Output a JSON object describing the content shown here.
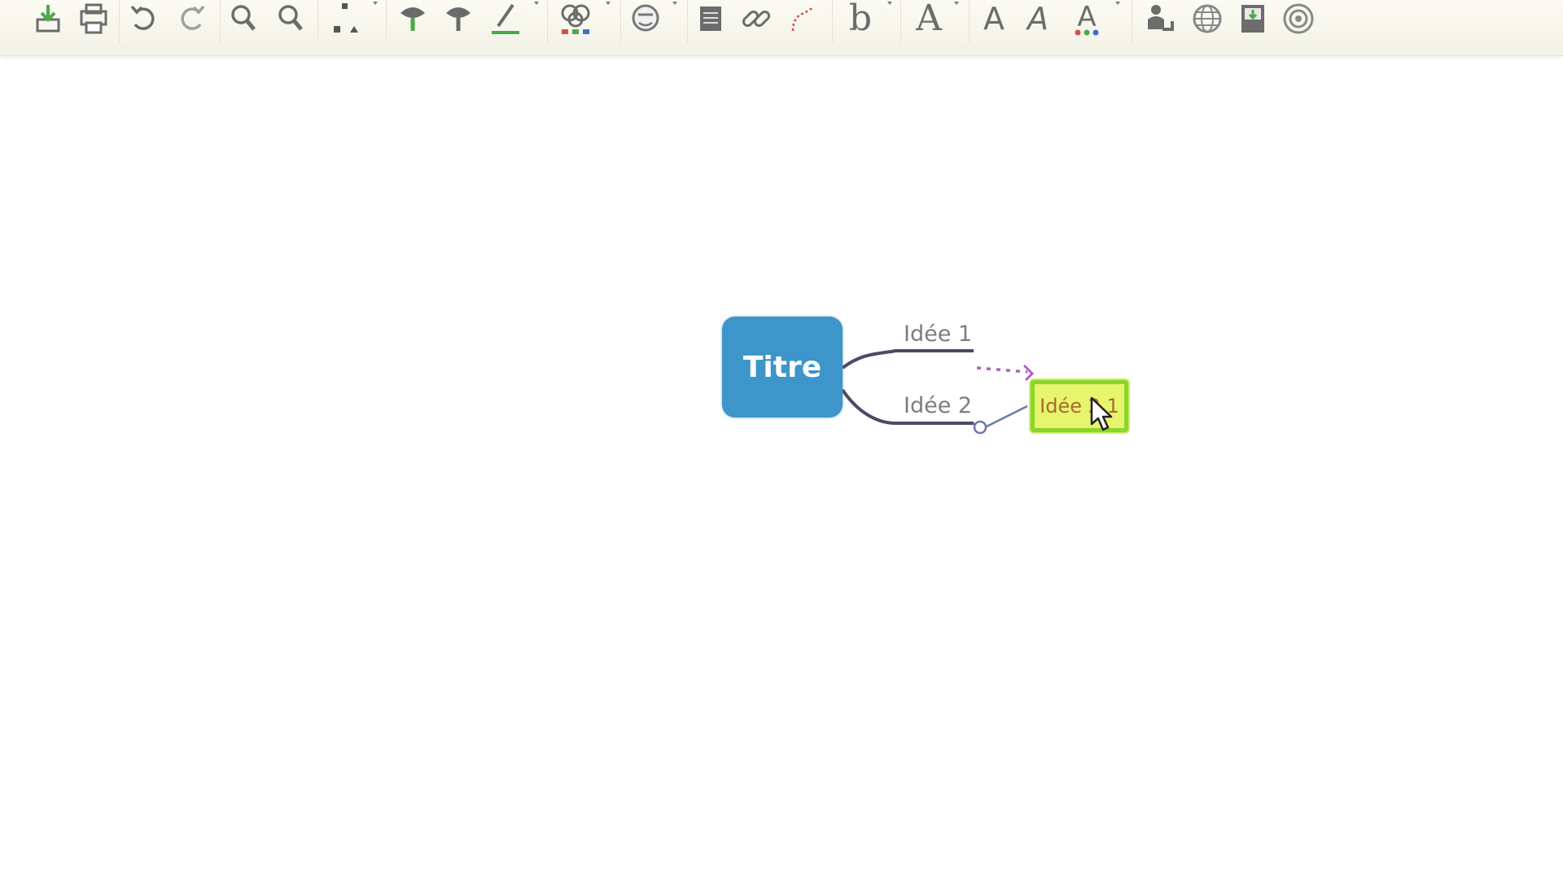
{
  "toolbar": {
    "buttons": [
      {
        "name": "export-icon",
        "tooltip": ""
      },
      {
        "name": "print-icon",
        "tooltip": ""
      },
      {
        "name": "undo-icon",
        "tooltip": ""
      },
      {
        "name": "redo-icon",
        "tooltip": ""
      },
      {
        "name": "zoom-in-icon",
        "tooltip": ""
      },
      {
        "name": "zoom-out-icon",
        "tooltip": ""
      },
      {
        "name": "layout-icon",
        "tooltip": ""
      },
      {
        "name": "add-child-topic-icon",
        "tooltip": ""
      },
      {
        "name": "add-sibling-topic-icon",
        "tooltip": ""
      },
      {
        "name": "line-color-icon",
        "tooltip": ""
      },
      {
        "name": "topic-color-icon",
        "tooltip": ""
      },
      {
        "name": "emoji-icon",
        "tooltip": ""
      },
      {
        "name": "note-icon",
        "tooltip": ""
      },
      {
        "name": "link-icon",
        "tooltip": ""
      },
      {
        "name": "relationship-icon",
        "tooltip": ""
      },
      {
        "name": "font-size-icon",
        "tooltip": ""
      },
      {
        "name": "font-style-icon",
        "tooltip": ""
      },
      {
        "name": "bold-icon",
        "tooltip": ""
      },
      {
        "name": "italic-icon",
        "tooltip": ""
      },
      {
        "name": "font-color-icon",
        "tooltip": ""
      },
      {
        "name": "share-users-icon",
        "tooltip": ""
      },
      {
        "name": "publish-web-icon",
        "tooltip": ""
      },
      {
        "name": "save-export-icon",
        "tooltip": ""
      },
      {
        "name": "history-icon",
        "tooltip": ""
      }
    ],
    "glyphs": {
      "font_size": "A",
      "bold": "A",
      "italic": "A",
      "font_color": "A",
      "relationship_b": "b"
    },
    "colors": {
      "icon_gray": "#6c6c6c",
      "icon_green": "#4aa84a",
      "icon_red": "#d25050",
      "icon_blue": "#3d6fd0"
    }
  },
  "mindmap": {
    "central_topic": "Titre",
    "branches": [
      {
        "label": "Idée 1"
      },
      {
        "label": "Idée 2",
        "children": [
          {
            "label": "Idée 2.1"
          }
        ]
      }
    ],
    "colors": {
      "central_fill": "#3d95c9",
      "branch_line": "#4a4a66",
      "relationship_line": "#b060c0",
      "selected_border": "#8ad62a",
      "selected_fill": "#e7f46e"
    }
  }
}
